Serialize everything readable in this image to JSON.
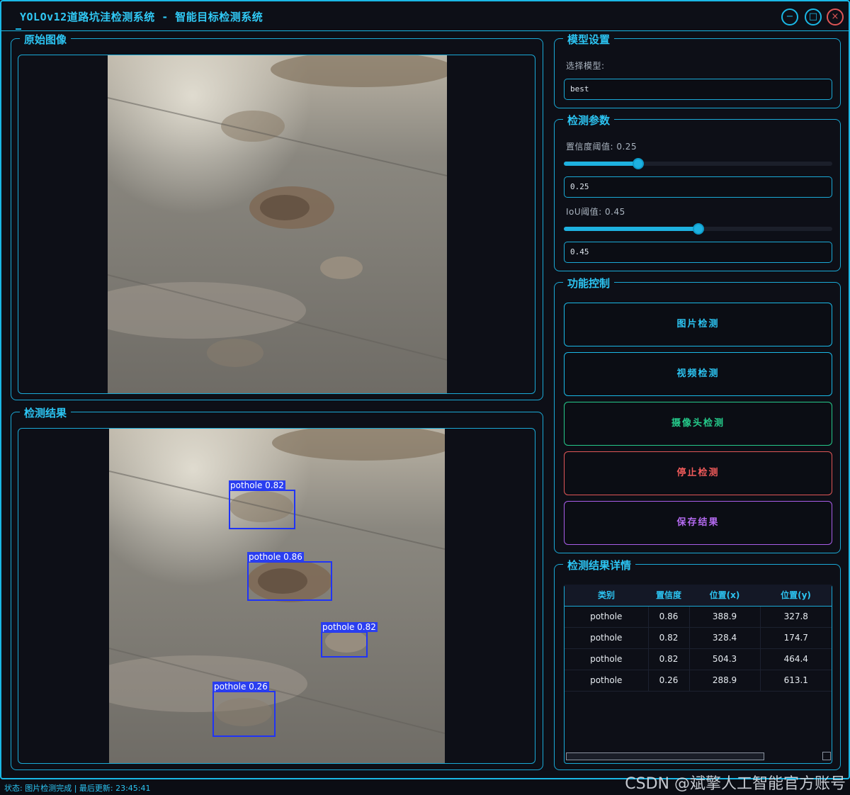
{
  "window": {
    "title": "YOLOv12道路坑洼检测系统 - 智能目标检测系统",
    "minimize_icon": "minimize-icon",
    "maximize_icon": "maximize-icon",
    "close_icon": "close-icon"
  },
  "original": {
    "title": "原始图像"
  },
  "result": {
    "title": "检测结果",
    "detections": [
      {
        "label": "pothole 0.82"
      },
      {
        "label": "pothole 0.86"
      },
      {
        "label": "pothole 0.82"
      },
      {
        "label": "pothole 0.26"
      }
    ]
  },
  "model": {
    "title": "模型设置",
    "select_label": "选择模型:",
    "selected": "best"
  },
  "params": {
    "title": "检测参数",
    "conf_label": "置信度阈值: 0.25",
    "conf_value": "0.25",
    "conf_fraction": 0.25,
    "iou_label": "IoU阈值: 0.45",
    "iou_value": "0.45",
    "iou_fraction": 0.45
  },
  "controls": {
    "title": "功能控制",
    "image_btn": "图片检测",
    "video_btn": "视频检测",
    "camera_btn": "摄像头检测",
    "stop_btn": "停止检测",
    "save_btn": "保存结果"
  },
  "details": {
    "title": "检测结果详情",
    "columns": [
      "类别",
      "置信度",
      "位置(x)",
      "位置(y)"
    ],
    "rows": [
      [
        "pothole",
        "0.86",
        "388.9",
        "327.8"
      ],
      [
        "pothole",
        "0.82",
        "328.4",
        "174.7"
      ],
      [
        "pothole",
        "0.82",
        "504.3",
        "464.4"
      ],
      [
        "pothole",
        "0.26",
        "288.9",
        "613.1"
      ]
    ]
  },
  "status": "状态: 图片检测完成 | 最后更新: 23:45:41",
  "watermark": "CSDN @斌擎人工智能官方账号",
  "colors": {
    "accent": "#1ab8e6",
    "camera": "#25c98a",
    "stop": "#e05656",
    "save": "#a85de8"
  }
}
